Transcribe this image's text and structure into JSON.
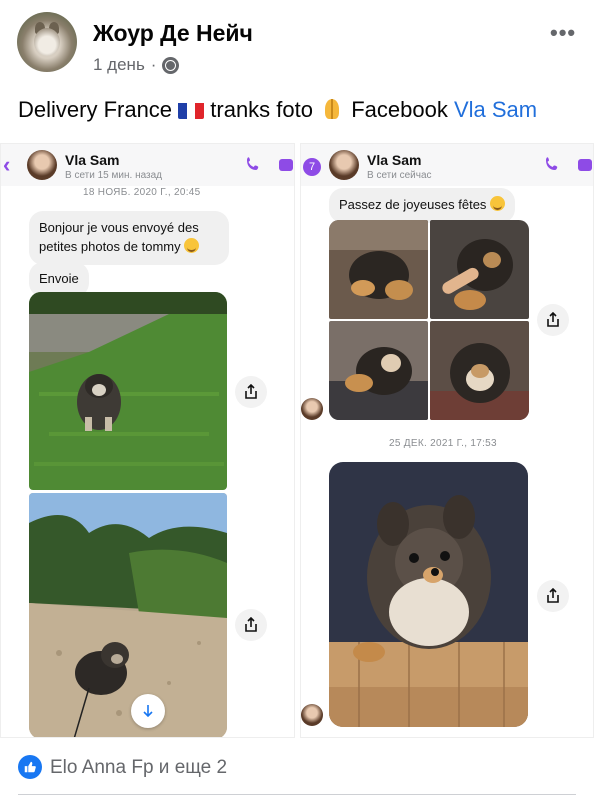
{
  "post": {
    "author": "Жоур Де Нейч",
    "time": "1 день",
    "separator": "·",
    "caption_part1": "Delivery France ",
    "caption_part2": " tranks foto ",
    "caption_part3": " Facebook ",
    "caption_link": "Vla Sam"
  },
  "left_chat": {
    "contact_name": "Vla Sam",
    "status": "В сети 15 мин. назад",
    "date": "18 НОЯБ. 2020 Г., 20:45",
    "message1": "Bonjour je vous envoyé des petites photos de tommy",
    "message2": "Envoie"
  },
  "right_chat": {
    "contact_name": "Vla Sam",
    "status": "В сети сейчас",
    "badge": "7",
    "message1": "Passez de joyeuses fêtes",
    "date": "25 ДЕК. 2021 Г., 17:53"
  },
  "reactions": {
    "text": "Elo Anna Fp и еще 2"
  },
  "colors": {
    "messenger_accent": "#8e4be6",
    "facebook_blue": "#1877f2",
    "link_blue": "#216fdb"
  },
  "icons": [
    "more-icon",
    "globe-icon",
    "back-icon",
    "phone-icon",
    "video-icon",
    "share-icon",
    "download-icon",
    "like-icon"
  ]
}
